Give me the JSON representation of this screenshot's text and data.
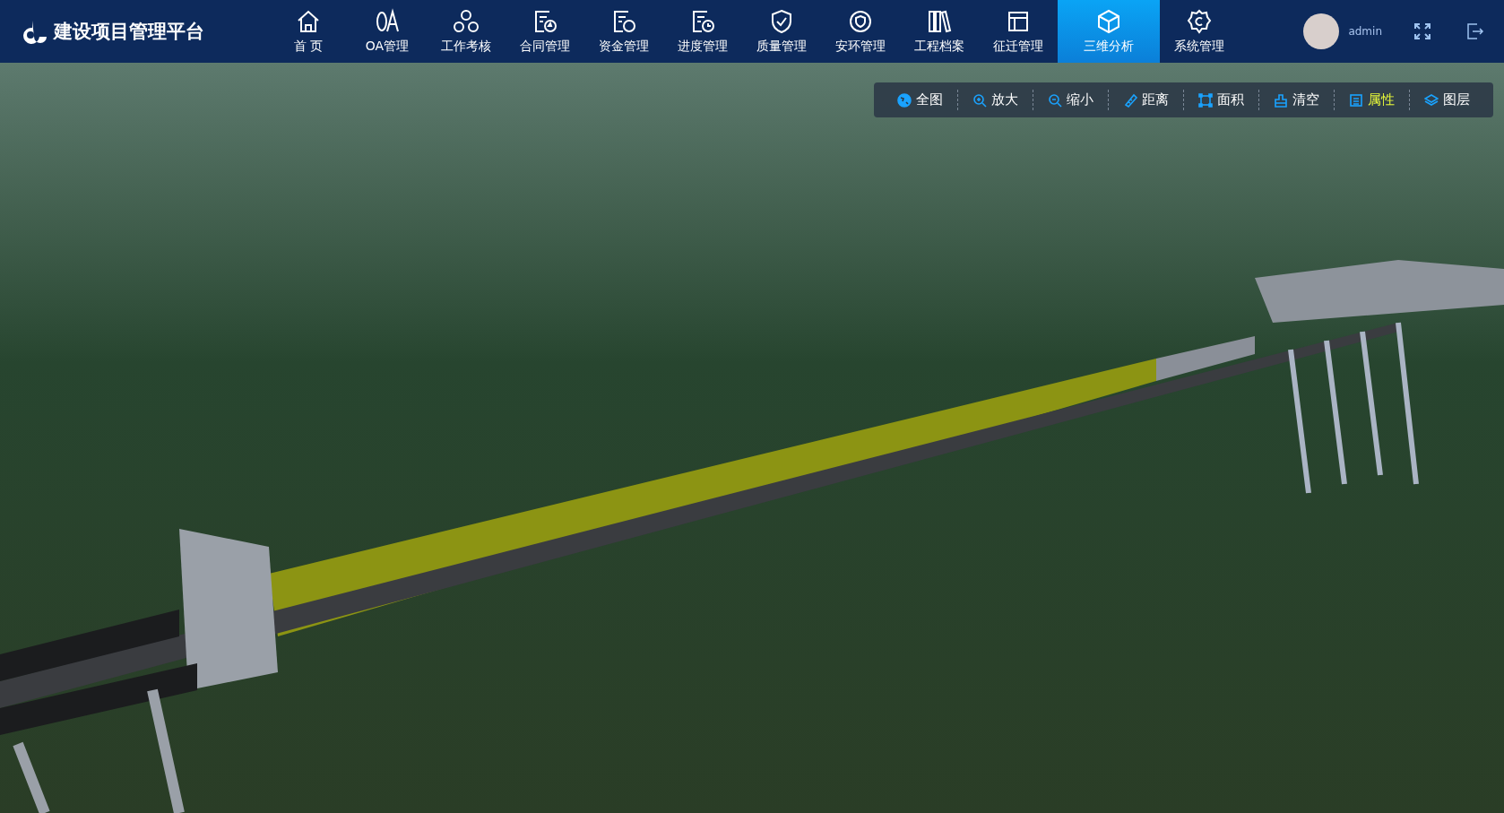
{
  "header": {
    "title": "建设项目管理平台"
  },
  "nav": [
    {
      "label": "首 页",
      "selected": false
    },
    {
      "label": "OA管理",
      "selected": false
    },
    {
      "label": "工作考核",
      "selected": false
    },
    {
      "label": "合同管理",
      "selected": false
    },
    {
      "label": "资金管理",
      "selected": false
    },
    {
      "label": "进度管理",
      "selected": false
    },
    {
      "label": "质量管理",
      "selected": false
    },
    {
      "label": "安环管理",
      "selected": false
    },
    {
      "label": "工程档案",
      "selected": false
    },
    {
      "label": "征迁管理",
      "selected": false
    },
    {
      "label": "三维分析",
      "selected": true
    },
    {
      "label": "系统管理",
      "selected": false
    }
  ],
  "user": {
    "name": "admin"
  },
  "toolbar": [
    {
      "label": "全图",
      "selected": false
    },
    {
      "label": "放大",
      "selected": false
    },
    {
      "label": "缩小",
      "selected": false
    },
    {
      "label": "距离",
      "selected": false
    },
    {
      "label": "面积",
      "selected": false
    },
    {
      "label": "清空",
      "selected": false
    },
    {
      "label": "属性",
      "selected": true
    },
    {
      "label": "图层",
      "selected": false
    }
  ]
}
